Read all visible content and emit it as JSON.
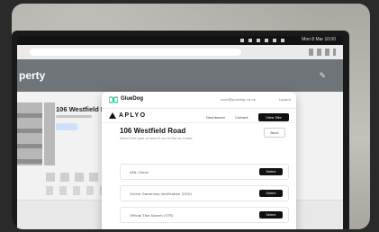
{
  "menubar": {
    "clock": "Mon 8 Mar 10:00"
  },
  "site": {
    "banner_title": "perty",
    "property_title": "106 Westfield R"
  },
  "popup": {
    "brand": "GlueDog",
    "user": "user@gluedog.co.uk",
    "logout": "Logout",
    "company": "APLYO",
    "nav": [
      "Dashboard",
      "Contact"
    ],
    "view_site": "View Site",
    "address": "106 Westfield Road",
    "instructions": "Select the type of search you'd like to create",
    "back": "Back",
    "searches": [
      {
        "label": "AML Check",
        "button": "Select"
      },
      {
        "label": "Online Ownership Verification (OOV)",
        "button": "Select"
      },
      {
        "label": "Official Title Search (OTS)",
        "button": "Select"
      }
    ]
  },
  "colors": {
    "accent": "#1ecfa0",
    "dark": "#111111",
    "banner": "#6f7478"
  }
}
